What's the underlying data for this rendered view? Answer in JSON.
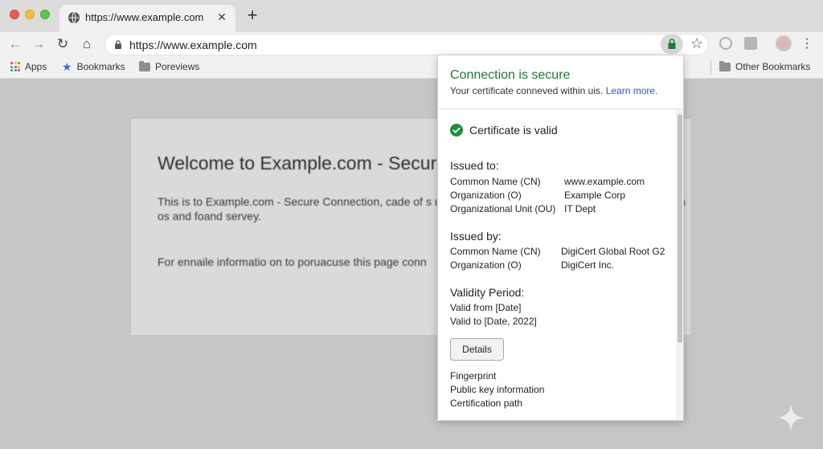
{
  "tab": {
    "title": "https://www.example.com",
    "close": "✕"
  },
  "toolbar": {
    "url": "https://www.example.com",
    "back": "←",
    "forward": "→",
    "reload": "↻",
    "home": "⌂",
    "star": "☆",
    "menu": "⋮"
  },
  "bookmarks": {
    "apps": "Apps",
    "bookmarks": "Bookmarks",
    "previews": "Poreviews",
    "other": "Other Bookmarks"
  },
  "page": {
    "title": "Welcome to Example.com - Secure",
    "body": "This is to Example.com - Secure Connection, cade of s uncreotable information- secure lawest connection os and foand servey.",
    "body2": "For ennaile informatio on to poruacuse this page conn"
  },
  "popup": {
    "title": "Connection is secure",
    "subtitle": "Your certificate conneved within uis.",
    "learn_more": "Learn more.",
    "valid": "Certificate is valid",
    "issued_to": {
      "heading": "Issued to:",
      "rows": [
        {
          "key": "Common Name (CN)",
          "value": "www.example.com"
        },
        {
          "key": "Organization (O)",
          "value": "Example Corp"
        },
        {
          "key": "Organizational Unit (OU)",
          "value": "IT Dept"
        }
      ]
    },
    "issued_by": {
      "heading": "Issued by:",
      "rows": [
        {
          "key": "Common Name (CN)",
          "value": "DigiCert Global Root G2"
        },
        {
          "key": "Organization (O)",
          "value": "DigiCert Inc."
        }
      ]
    },
    "validity": {
      "heading": "Validity Period:",
      "from": "Valid from [Date]",
      "to": "Valid to [Date, 2022]"
    },
    "details_button": "Details",
    "links": [
      "Fingerprint",
      "Public key information",
      "Certification path"
    ]
  },
  "colors": {
    "secure_green": "#1e7b34",
    "link_blue": "#1a5fb4",
    "check_green": "#1e8e3e"
  },
  "icons": {
    "tab": "globe-icon",
    "close": "close-icon",
    "new_tab": "plus-icon",
    "lock": "lock-icon",
    "star": "star-icon",
    "check": "check-circle-icon",
    "menu": "more-vert-icon",
    "apps": "apps-grid-icon",
    "folder": "folder-icon"
  }
}
